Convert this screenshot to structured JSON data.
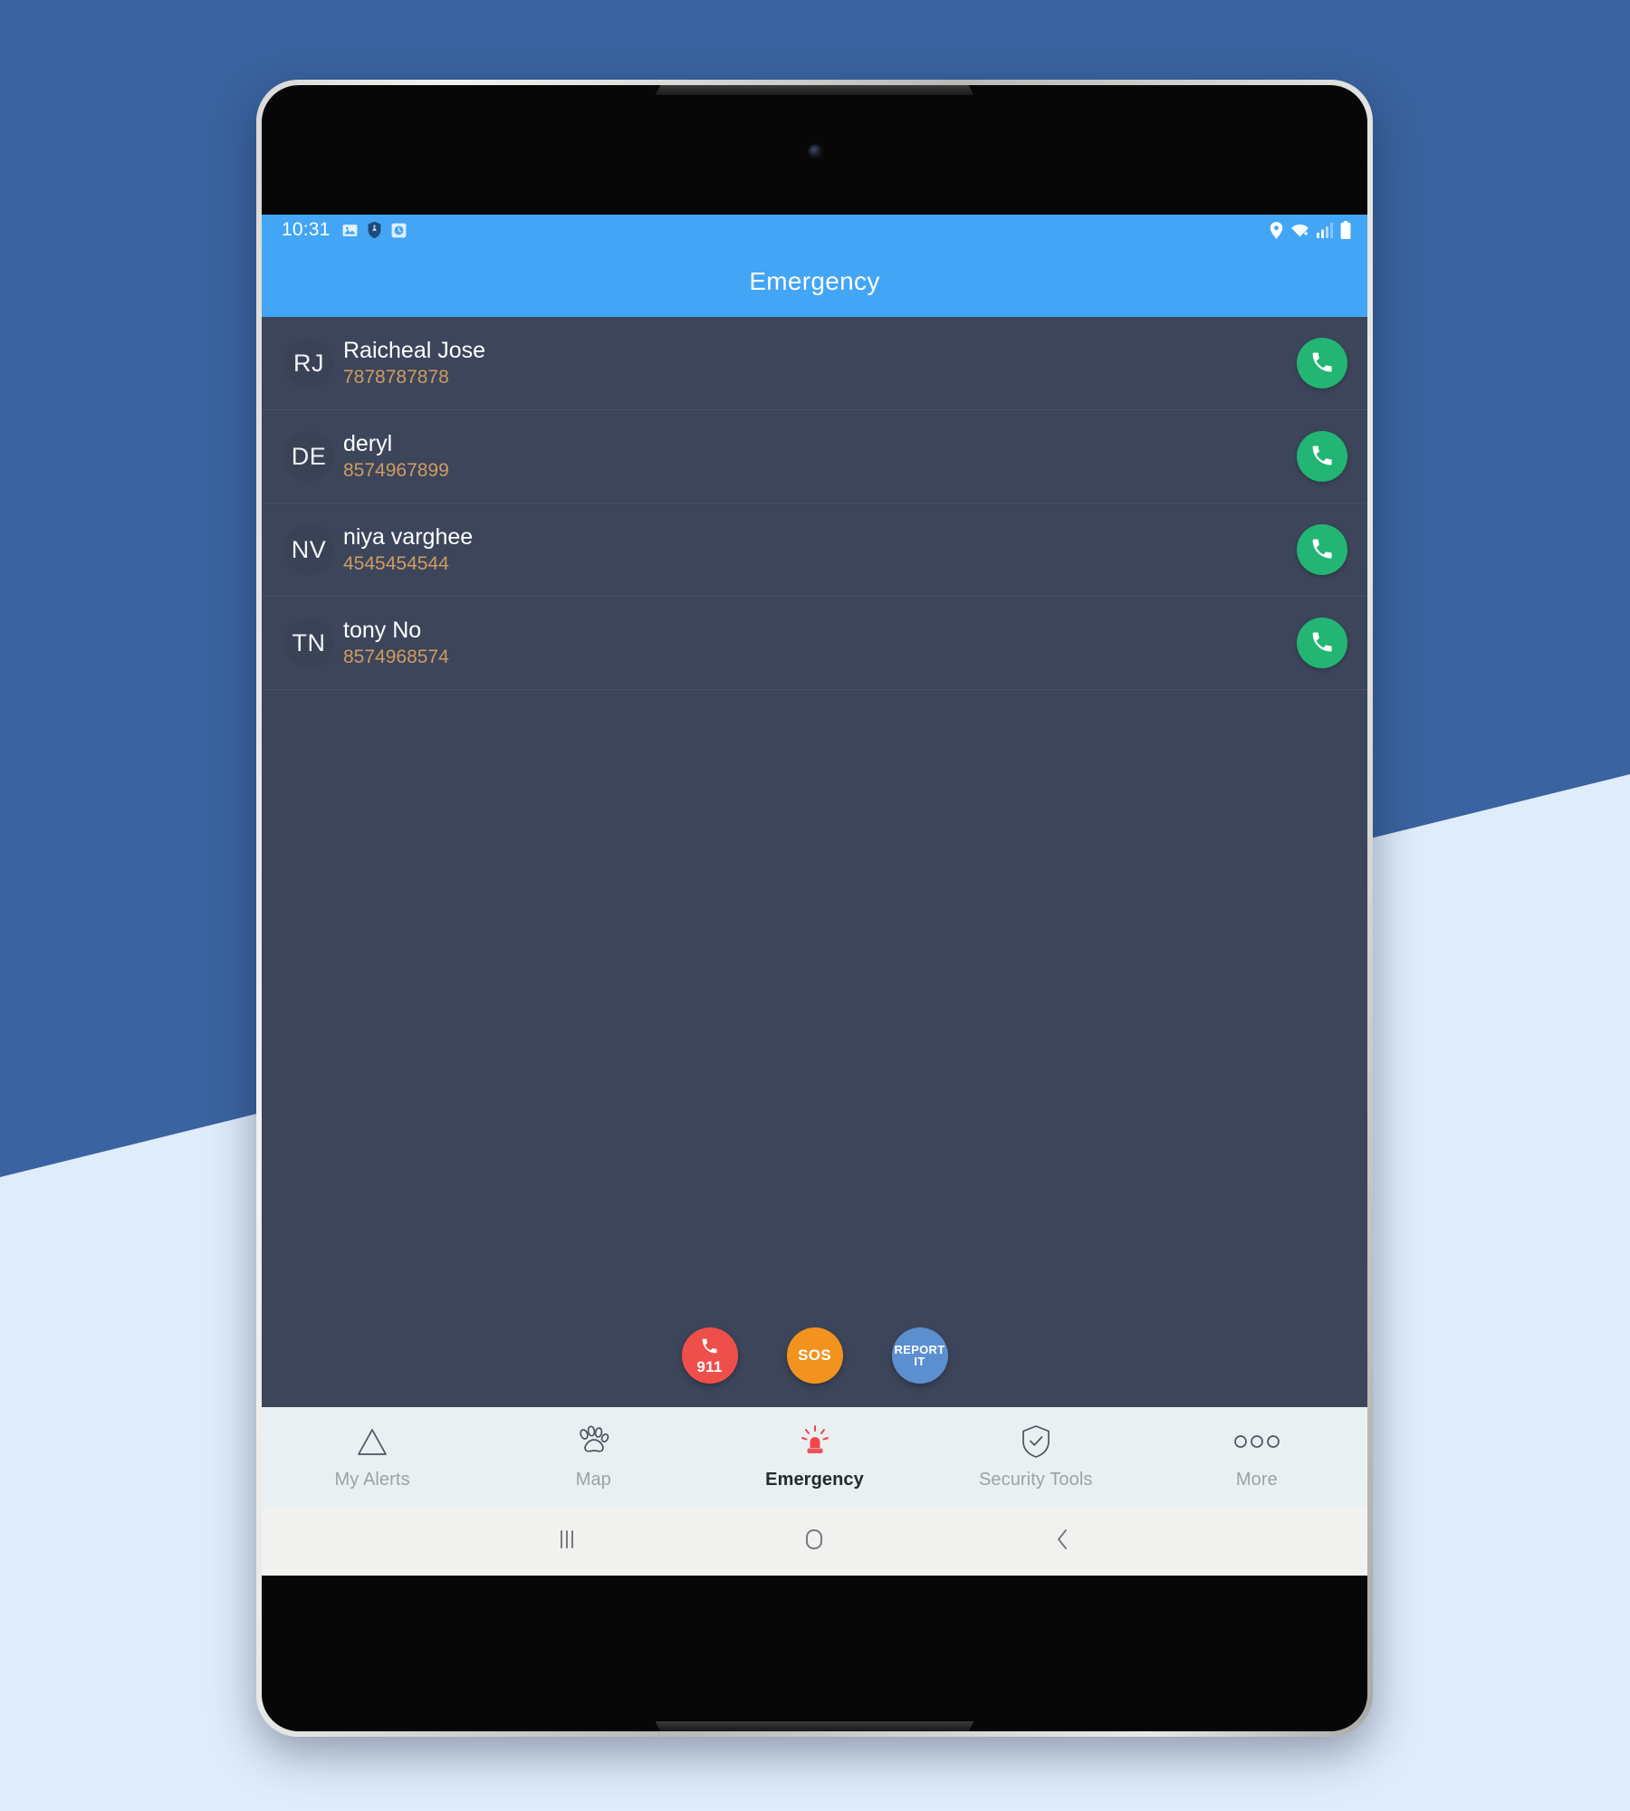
{
  "theme": {
    "background_blue": "#3a639f",
    "background_light": "#dfecfb",
    "appbar_blue": "#42a5f5",
    "screen_bg": "#3c455a",
    "phone_accent": "#cf9b63",
    "call_green": "#22b573",
    "fab_911": "#ef4f4a",
    "fab_sos": "#f3931f",
    "fab_report": "#5b8fd0",
    "nav_bg": "#e9f0f2",
    "siren_red": "#f0464a"
  },
  "status_bar": {
    "time": "10:31",
    "left_icons": [
      "image-icon",
      "shield-icon",
      "alarm-clock-icon"
    ],
    "right_icons": [
      "location-pin-icon",
      "wifi-icon",
      "cellular-signal-icon",
      "battery-icon"
    ]
  },
  "app_bar": {
    "title": "Emergency"
  },
  "contacts": [
    {
      "initials": "RJ",
      "name": "Raicheal Jose",
      "phone": "7878787878",
      "action": "call-button"
    },
    {
      "initials": "DE",
      "name": "deryl",
      "phone": "8574967899",
      "action": "call-button"
    },
    {
      "initials": "NV",
      "name": "niya varghee",
      "phone": "4545454544",
      "action": "call-button"
    },
    {
      "initials": "TN",
      "name": "tony No",
      "phone": "8574968574",
      "action": "call-button"
    }
  ],
  "fabs": [
    {
      "label": "911",
      "icon": "phone-icon",
      "color": "#ef4f4a"
    },
    {
      "label": "SOS",
      "icon": "",
      "color": "#f3931f"
    },
    {
      "label": "REPORT IT",
      "icon": "",
      "color": "#5b8fd0"
    }
  ],
  "bottom_nav": [
    {
      "label": "My Alerts",
      "icon": "triangle-alert-icon",
      "active": false
    },
    {
      "label": "Map",
      "icon": "paw-print-icon",
      "active": false
    },
    {
      "label": "Emergency",
      "icon": "siren-icon",
      "active": true
    },
    {
      "label": "Security Tools",
      "icon": "shield-check-icon",
      "active": false
    },
    {
      "label": "More",
      "icon": "three-dots-icon",
      "active": false
    }
  ],
  "system_nav": [
    {
      "name": "recents-button",
      "icon": "vertical-bars-icon"
    },
    {
      "name": "home-button",
      "icon": "circle-icon"
    },
    {
      "name": "back-button",
      "icon": "chevron-left-icon"
    }
  ]
}
